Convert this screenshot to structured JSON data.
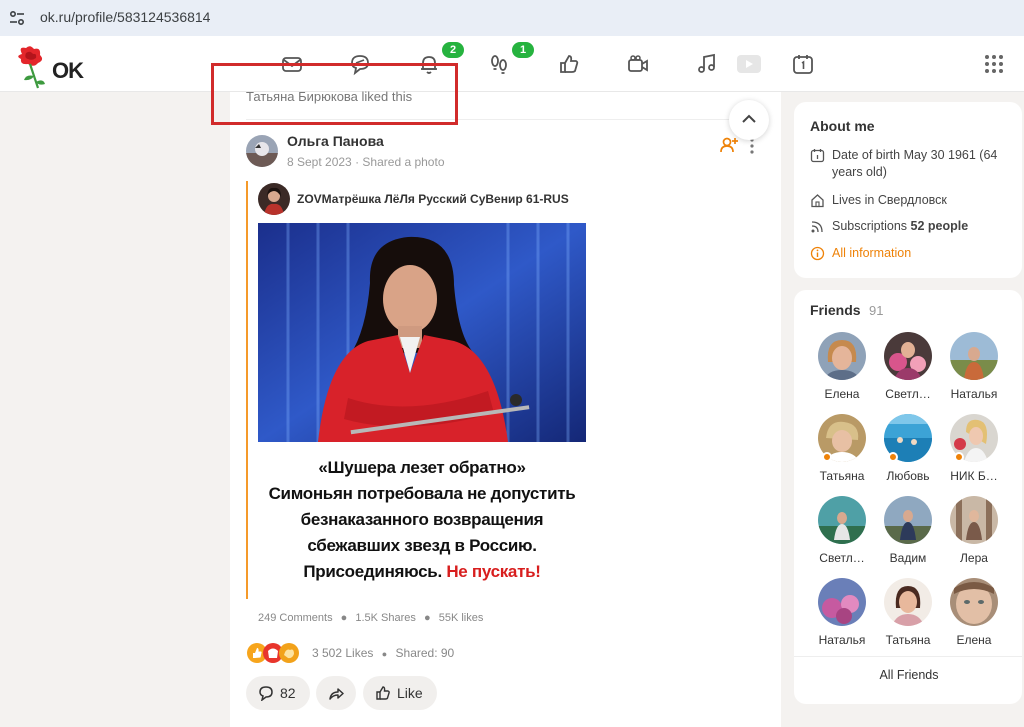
{
  "browser": {
    "url": "ok.ru/profile/583124536814"
  },
  "logo": {
    "text": "OK"
  },
  "nav": {
    "notifications_badge": "2",
    "guests_badge": "1",
    "icons": [
      "mail-icon",
      "chat-icon",
      "bell-icon",
      "footprints-icon",
      "thumbs-up-icon",
      "video-camera-icon",
      "music-icon",
      "video-play-icon",
      "calendar-icon"
    ]
  },
  "feed": {
    "liked_by": "Татьяна Бирюкова liked this",
    "post": {
      "author": "Ольга Панова",
      "date": "8 Sept 2023",
      "action": "Shared a photo",
      "original_author": "ZOVМатрёшка ЛёЛя Русский СуВенир 61-RUS",
      "caption_lines": [
        "«Шушера лезет обратно»",
        "Симоньян потребовала не допустить",
        "безнаказанного возвращения",
        "сбежавших звезд в Россию.",
        "Присоединяюсь."
      ],
      "caption_red": "Не пускать!",
      "comments_count": "249 Comments",
      "shares_count": "1.5K Shares",
      "likes_count": "55K likes",
      "reactions_text": "3 502 Likes",
      "shared_text": "Shared: 90",
      "comment_btn": "82",
      "like_btn": "Like"
    }
  },
  "about": {
    "title": "About me",
    "birth": "Date of birth May 30 1961 (64 years old)",
    "lives": "Lives in Свердловск",
    "subs_label": "Subscriptions",
    "subs_value": "52 people",
    "all_info": "All information"
  },
  "friends": {
    "title": "Friends",
    "count": "91",
    "items": [
      {
        "name": "Елена"
      },
      {
        "name": "Светл…"
      },
      {
        "name": "Наталья"
      },
      {
        "name": "Татьяна"
      },
      {
        "name": "Любовь"
      },
      {
        "name": "НИК Б…"
      },
      {
        "name": "Светл…"
      },
      {
        "name": "Вадим"
      },
      {
        "name": "Лера"
      },
      {
        "name": "Наталья"
      },
      {
        "name": "Татьяна"
      },
      {
        "name": "Елена"
      }
    ],
    "all_label": "All Friends"
  },
  "colors": {
    "accent": "#ee8208",
    "badge": "#26b33f",
    "highlight": "#d12b2b"
  }
}
